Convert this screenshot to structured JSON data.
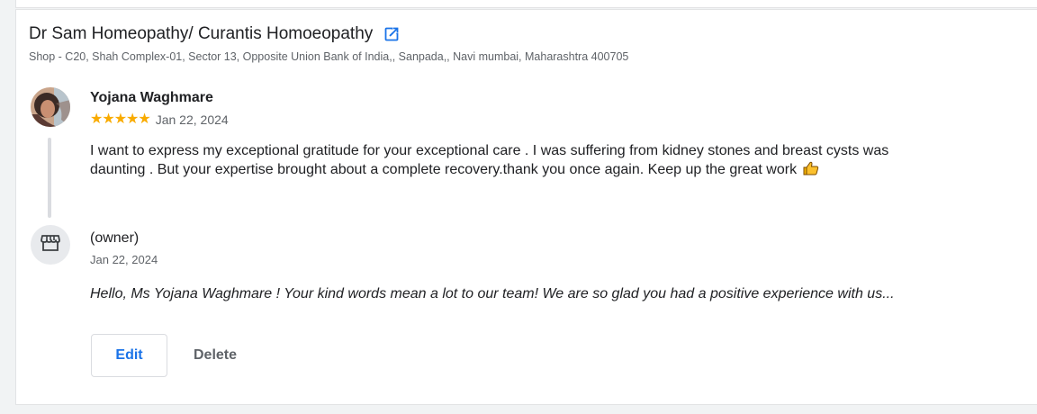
{
  "business": {
    "name": "Dr Sam Homeopathy/ Curantis Homoeopathy",
    "address": "Shop - C20, Shah Complex-01, Sector 13, Opposite Union Bank of India,, Sanpada,, Navi mumbai, Maharashtra 400705",
    "link_icon": "open-in-new-icon"
  },
  "review": {
    "reviewer_name": "Yojana Waghmare",
    "stars_text": "★★★★★",
    "rating": 5,
    "date": "Jan 22, 2024",
    "text": "I want to express my exceptional gratitude for your exceptional care . I was suffering from kidney stones and breast cysts was daunting . But your expertise brought about a complete recovery.thank you once again. Keep up the great work",
    "emoji_icon": "thumbs-up-icon"
  },
  "owner_reply": {
    "label": "(owner)",
    "date": "Jan 22, 2024",
    "text": "Hello, Ms Yojana Waghmare ! Your kind words mean a lot to our team! We are so glad you had a positive experience with us...",
    "avatar_icon": "storefront-icon"
  },
  "actions": {
    "edit_label": "Edit",
    "delete_label": "Delete"
  },
  "colors": {
    "star": "#f9ab00",
    "link": "#1a73e8",
    "secondary_text": "#5f6368"
  }
}
